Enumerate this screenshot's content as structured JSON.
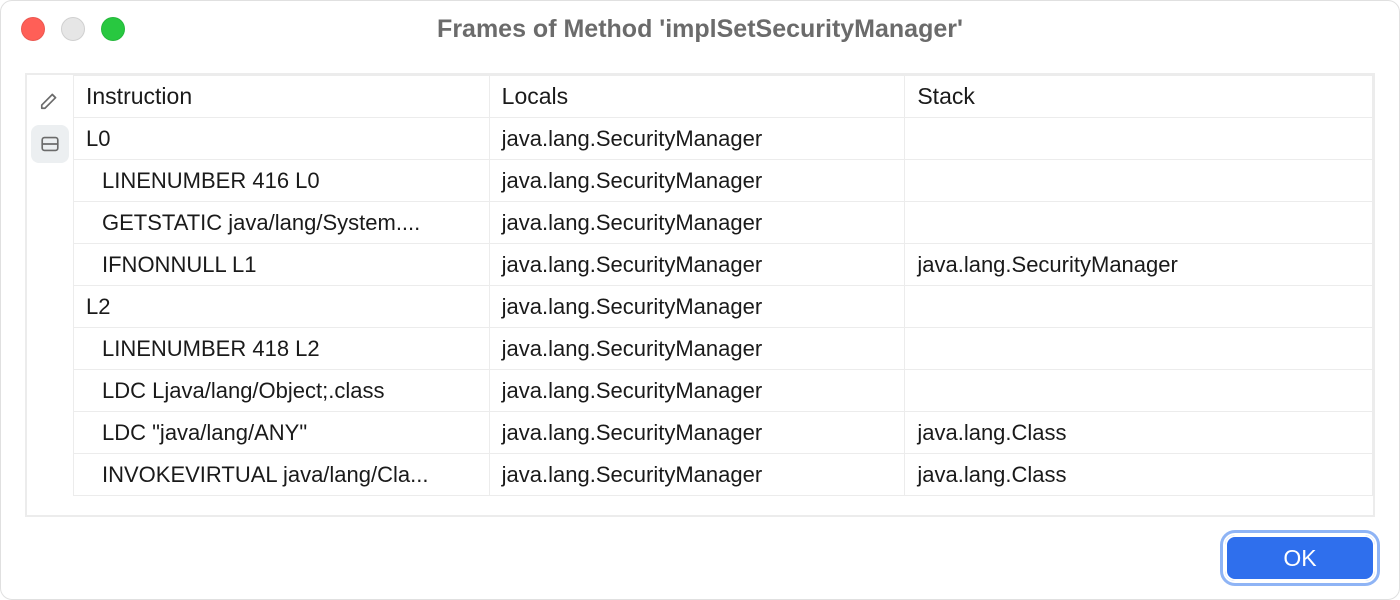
{
  "window": {
    "title": "Frames of Method 'implSetSecurityManager'"
  },
  "columns": {
    "instruction": "Instruction",
    "locals": "Locals",
    "stack": "Stack"
  },
  "rows": [
    {
      "instruction": "L0",
      "depth": 0,
      "locals": "java.lang.SecurityManager",
      "stack": ""
    },
    {
      "instruction": "LINENUMBER 416 L0",
      "depth": 1,
      "locals": "java.lang.SecurityManager",
      "stack": ""
    },
    {
      "instruction": "GETSTATIC java/lang/System....",
      "depth": 1,
      "locals": "java.lang.SecurityManager",
      "stack": ""
    },
    {
      "instruction": "IFNONNULL L1",
      "depth": 1,
      "locals": "java.lang.SecurityManager",
      "stack": "java.lang.SecurityManager"
    },
    {
      "instruction": "L2",
      "depth": 0,
      "locals": "java.lang.SecurityManager",
      "stack": ""
    },
    {
      "instruction": "LINENUMBER 418 L2",
      "depth": 1,
      "locals": "java.lang.SecurityManager",
      "stack": ""
    },
    {
      "instruction": "LDC Ljava/lang/Object;.class",
      "depth": 1,
      "locals": "java.lang.SecurityManager",
      "stack": ""
    },
    {
      "instruction": "LDC \"java/lang/ANY\"",
      "depth": 1,
      "locals": "java.lang.SecurityManager",
      "stack": "java.lang.Class"
    },
    {
      "instruction": "INVOKEVIRTUAL java/lang/Cla...",
      "depth": 1,
      "locals": "java.lang.SecurityManager",
      "stack": "java.lang.Class"
    }
  ],
  "buttons": {
    "ok": "OK"
  }
}
